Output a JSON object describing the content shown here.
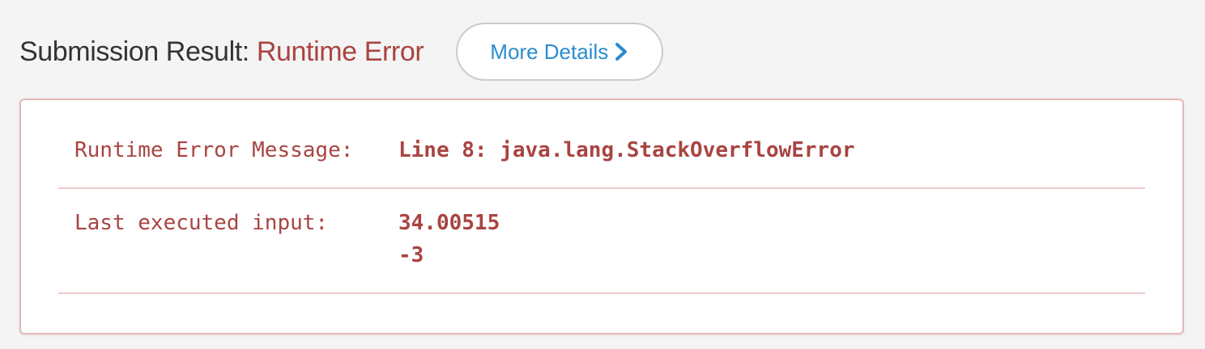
{
  "header": {
    "title_prefix": "Submission Result: ",
    "status": "Runtime Error",
    "more_details_label": "More Details"
  },
  "result": {
    "error_message_key": "Runtime Error Message:",
    "error_message_value": "Line 8: java.lang.StackOverflowError",
    "last_input_key": "Last executed input:",
    "last_input_lines": [
      "34.00515",
      "-3"
    ]
  },
  "colors": {
    "error": "#a94442",
    "link": "#2a8ccf",
    "panel_border": "#e4b9b9"
  },
  "icons": {
    "more_details": "chevron-right-icon"
  }
}
